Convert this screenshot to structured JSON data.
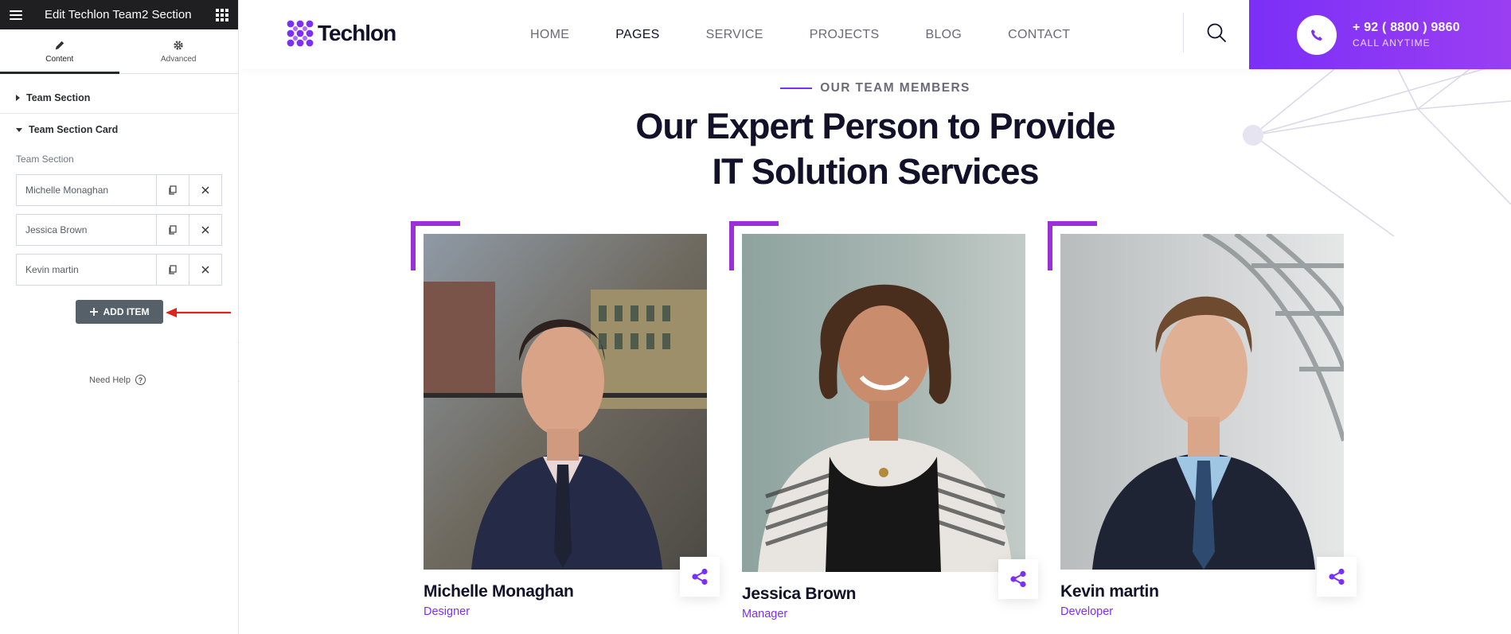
{
  "editor": {
    "title": "Edit Techlon Team2 Section",
    "tabs": [
      {
        "label": "Content",
        "icon": "pencil-icon",
        "active": true
      },
      {
        "label": "Advanced",
        "icon": "gear-icon",
        "active": false
      }
    ],
    "sections": [
      {
        "label": "Team Section",
        "open": false
      },
      {
        "label": "Team Section Card",
        "open": true
      }
    ],
    "field_label": "Team Section",
    "items": [
      {
        "title": "Michelle Monaghan"
      },
      {
        "title": "Jessica Brown"
      },
      {
        "title": "Kevin martin"
      }
    ],
    "add_item_label": "ADD ITEM",
    "need_help_label": "Need Help",
    "arrow_color": "#e0211c"
  },
  "site": {
    "logo_text": "Techlon",
    "nav": [
      "HOME",
      "PAGES",
      "SERVICE",
      "PROJECTS",
      "BLOG",
      "CONTACT"
    ],
    "active_nav": "PAGES",
    "phone": "+ 92 ( 8800 ) 9860",
    "call_label": "CALL ANYTIME",
    "eyebrow": "OUR TEAM MEMBERS",
    "heading_line1": "Our Expert Person to Provide",
    "heading_line2": "IT Solution Services",
    "accent_color": "#7b2ff7",
    "team": [
      {
        "name": "Michelle Monaghan",
        "role": "Designer"
      },
      {
        "name": "Jessica Brown",
        "role": "Manager"
      },
      {
        "name": "Kevin martin",
        "role": "Developer"
      }
    ]
  }
}
